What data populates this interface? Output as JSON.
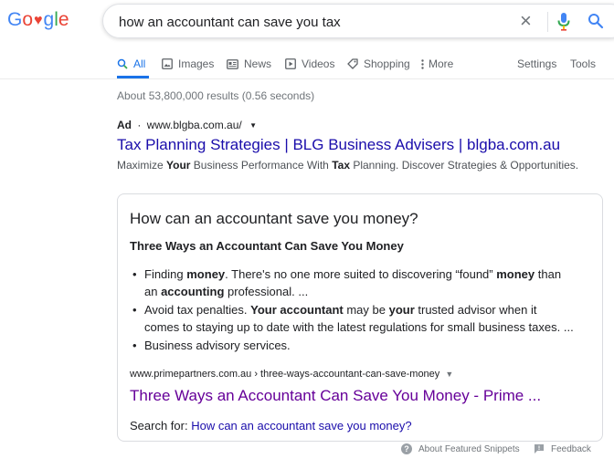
{
  "logo": {
    "letters": [
      "G",
      "o",
      "o",
      "g",
      "l",
      "e"
    ]
  },
  "search": {
    "query": "how an accountant can save you tax"
  },
  "tabs": [
    {
      "label": "All",
      "icon": "search-icon"
    },
    {
      "label": "Images",
      "icon": "image-icon"
    },
    {
      "label": "News",
      "icon": "news-icon"
    },
    {
      "label": "Videos",
      "icon": "video-icon"
    },
    {
      "label": "Shopping",
      "icon": "tag-icon"
    },
    {
      "label": "More",
      "icon": "more-vert-icon"
    }
  ],
  "settings_label": "Settings",
  "tools_label": "Tools",
  "stats": "About 53,800,000 results (0.56 seconds)",
  "ad": {
    "badge": "Ad",
    "sep": "·",
    "url": "www.blgba.com.au/",
    "title": "Tax Planning Strategies | BLG Business Advisers | blgba.com.au",
    "desc_parts": [
      "Maximize ",
      "Your",
      " Business Performance With ",
      "Tax",
      " Planning. Discover Strategies & Opportunities."
    ]
  },
  "snippet": {
    "question": "How can an accountant save you money?",
    "heading": "Three Ways an Accountant Can Save You Money",
    "bullets": [
      {
        "line1": [
          "Finding ",
          "money",
          ". There's no one more suited to discovering “found” ",
          "money",
          " than"
        ],
        "line2": [
          "an ",
          "accounting",
          " professional. ..."
        ]
      },
      {
        "line1": [
          "Avoid tax penalties. ",
          "Your accountant",
          " may be ",
          "your",
          " trusted advisor when it"
        ],
        "line2": [
          "comes to staying up to date with the latest regulations for small business taxes. ..."
        ]
      },
      {
        "line1": [
          "Business advisory services."
        ]
      }
    ],
    "cite": "www.primepartners.com.au › three-ways-accountant-can-save-money",
    "result_title": "Three Ways an Accountant Can Save You Money - Prime ...",
    "search_for_label": "Search for: ",
    "search_for_link": "How can an accountant save you money?"
  },
  "footer": {
    "about_label": "About Featured Snippets",
    "feedback_label": "Feedback"
  },
  "colors": {
    "link": "#1a0dab",
    "visited": "#660099",
    "accent": "#1a73e8"
  }
}
